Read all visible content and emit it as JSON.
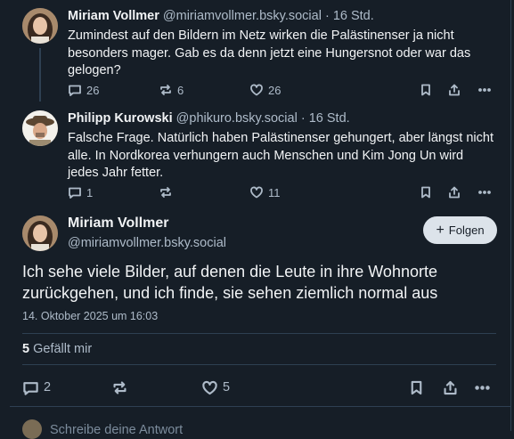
{
  "posts": [
    {
      "author_name": "Miriam Vollmer",
      "handle": "@miriamvollmer.bsky.social",
      "separator": "·",
      "time": "16 Std.",
      "text": "Zumindest auf den Bildern im Netz wirken die Palästinenser ja nicht besonders mager. Gab es da denn jetzt eine Hungersnot oder war das gelogen?",
      "replies": "26",
      "reposts": "6",
      "likes": "26"
    },
    {
      "author_name": "Philipp Kurowski",
      "handle": "@phikuro.bsky.social",
      "separator": "·",
      "time": "16 Std.",
      "text": "Falsche Frage. Natürlich haben Palästinenser gehungert, aber längst nicht alle. In Nordkorea verhungern auch Menschen und Kim Jong Un wird jedes Jahr fetter.",
      "replies": "1",
      "reposts": "",
      "likes": "11"
    }
  ],
  "main_post": {
    "author_name": "Miriam Vollmer",
    "handle": "@miriamvollmer.bsky.social",
    "follow_label": "Folgen",
    "text": "Ich sehe viele Bilder, auf denen die Leute in ihre Wohnorte zurückgehen, und ich finde, sie sehen ziemlich normal aus",
    "date": "14. Oktober 2025 um 16:03",
    "like_count": "5",
    "like_label": " Gefällt mir",
    "replies": "2",
    "reposts": "",
    "likes": "5"
  },
  "reply_box": {
    "placeholder": "Schreibe deine Antwort"
  },
  "icons": [
    "reply-icon",
    "repost-icon",
    "like-icon",
    "bookmark-icon",
    "share-icon",
    "more-icon",
    "plus-icon"
  ],
  "colors": {
    "background": "#161e27",
    "text": "#f1f3f5",
    "muted": "#aebbc9",
    "border": "#2e4052",
    "button": "#dce3ea"
  }
}
